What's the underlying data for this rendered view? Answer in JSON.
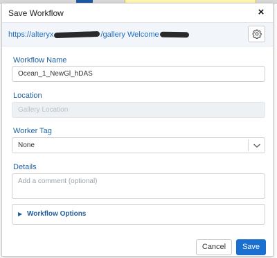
{
  "dialog": {
    "title": "Save Workflow",
    "close_icon": "×"
  },
  "url_bar": {
    "url_prefix": "https://alteryx",
    "url_path": "/gallery",
    "welcome_text": "Welcome"
  },
  "form": {
    "workflow_name": {
      "label": "Workflow Name",
      "value": "Ocean_1_NewGl_hDAS"
    },
    "location": {
      "label": "Location",
      "placeholder": "Gallery Location"
    },
    "worker_tag": {
      "label": "Worker Tag",
      "selected": "None"
    },
    "details": {
      "label": "Details",
      "placeholder": "Add a comment (optional)"
    },
    "workflow_options": {
      "label": "Workflow Options",
      "caret": "▶"
    }
  },
  "actions": {
    "cancel_label": "Cancel",
    "save_label": "Save"
  },
  "colors": {
    "accent": "#1b6fce",
    "label_blue": "#1f5f9e",
    "url_blue": "#1f6fc4"
  },
  "icons": {
    "close": "close-icon",
    "settings": "gear-icon",
    "dropdown": "chevron-down-icon",
    "expand": "caret-right-icon"
  }
}
